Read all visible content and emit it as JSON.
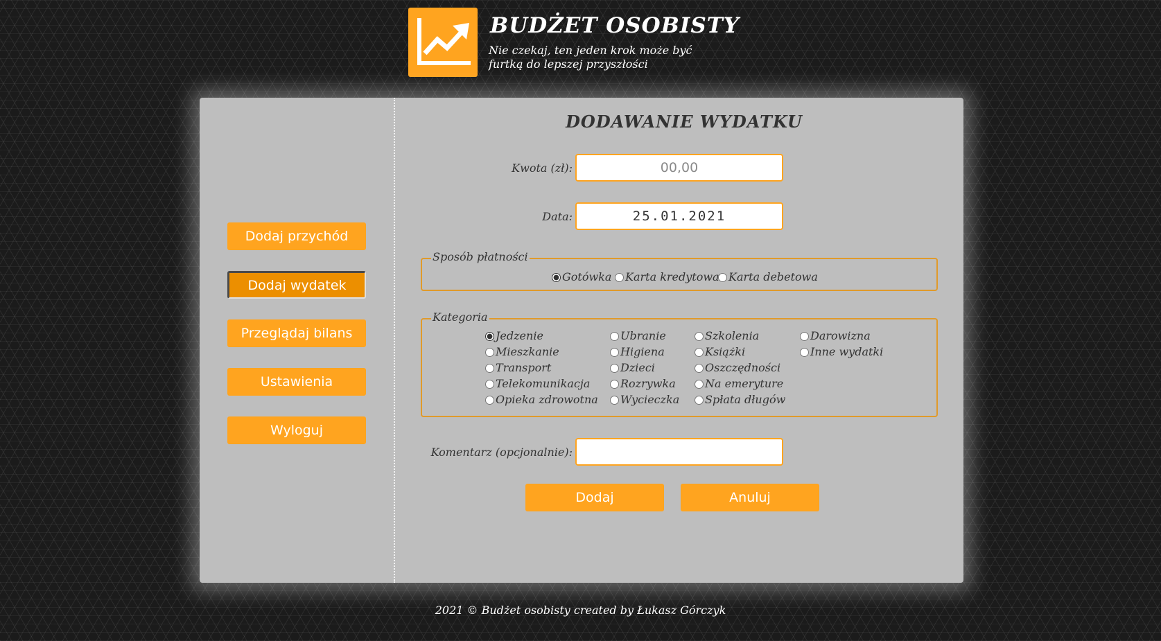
{
  "header": {
    "title": "BUDŻET OSOBISTY",
    "subtitle": "Nie czekaj, ten jeden krok może być furtką do lepszej przyszłości",
    "logo_icon": "chart-trending-up-icon",
    "accent_color": "#ffa41f"
  },
  "nav": {
    "items": [
      {
        "label": "Dodaj przychód",
        "active": false
      },
      {
        "label": "Dodaj wydatek",
        "active": true
      },
      {
        "label": "Przeglądaj bilans",
        "active": false
      },
      {
        "label": "Ustawienia",
        "active": false
      },
      {
        "label": "Wyloguj",
        "active": false
      }
    ]
  },
  "form": {
    "title": "DODAWANIE WYDATKU",
    "amount": {
      "label": "Kwota (zł):",
      "placeholder": "00,00",
      "value": ""
    },
    "date": {
      "label": "Data:",
      "value": "25.01.2021"
    },
    "payment": {
      "legend": "Sposób płatności",
      "options": [
        "Gotówka",
        "Karta kredytowa",
        "Karta debetowa"
      ],
      "selected": "Gotówka"
    },
    "category": {
      "legend": "Kategoria",
      "options": [
        "Jedzenie",
        "Mieszkanie",
        "Transport",
        "Telekomunikacja",
        "Opieka zdrowotna",
        "Ubranie",
        "Higiena",
        "Dzieci",
        "Rozrywka",
        "Wycieczka",
        "Szkolenia",
        "Książki",
        "Oszczędności",
        "Na emeryture",
        "Spłata długów",
        "Darowizna",
        "Inne wydatki"
      ],
      "selected": "Jedzenie"
    },
    "comment": {
      "label": "Komentarz (opcjonalnie):",
      "value": ""
    },
    "submit_label": "Dodaj",
    "cancel_label": "Anuluj"
  },
  "footer": {
    "text": "2021 © Budżet osobisty created by Łukasz Górczyk"
  }
}
